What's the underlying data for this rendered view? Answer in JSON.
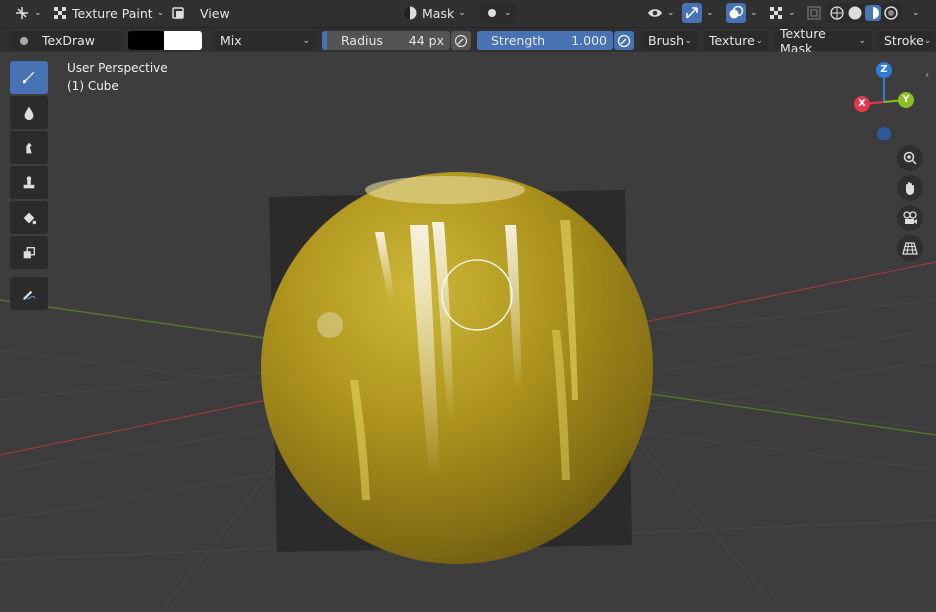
{
  "header": {
    "mode_label": "Texture Paint",
    "view_menu": "View",
    "mask_label": "Mask"
  },
  "toolbar": {
    "brush_name": "TexDraw",
    "blend_mode": "Mix",
    "radius_label": "Radius",
    "radius_value": "44 px",
    "strength_label": "Strength",
    "strength_value": "1.000",
    "brush_menu": "Brush",
    "texture_menu": "Texture",
    "texture_mask_menu": "Texture Mask",
    "stroke_menu": "Stroke",
    "primary_color": "#000000",
    "secondary_color": "#ffffff"
  },
  "viewport": {
    "perspective_label": "User Perspective",
    "object_label": "(1) Cube"
  },
  "gizmo": {
    "z": "Z",
    "x": "X",
    "y": "Y"
  },
  "colors": {
    "accent": "#4772b3",
    "axis_x": "#e8364f",
    "axis_y": "#8bc024",
    "axis_z": "#2d7cd6"
  },
  "tools": [
    "draw-brush-icon",
    "soften-icon",
    "smear-icon",
    "clone-icon",
    "fill-icon",
    "mask-icon",
    "annotate-icon"
  ]
}
